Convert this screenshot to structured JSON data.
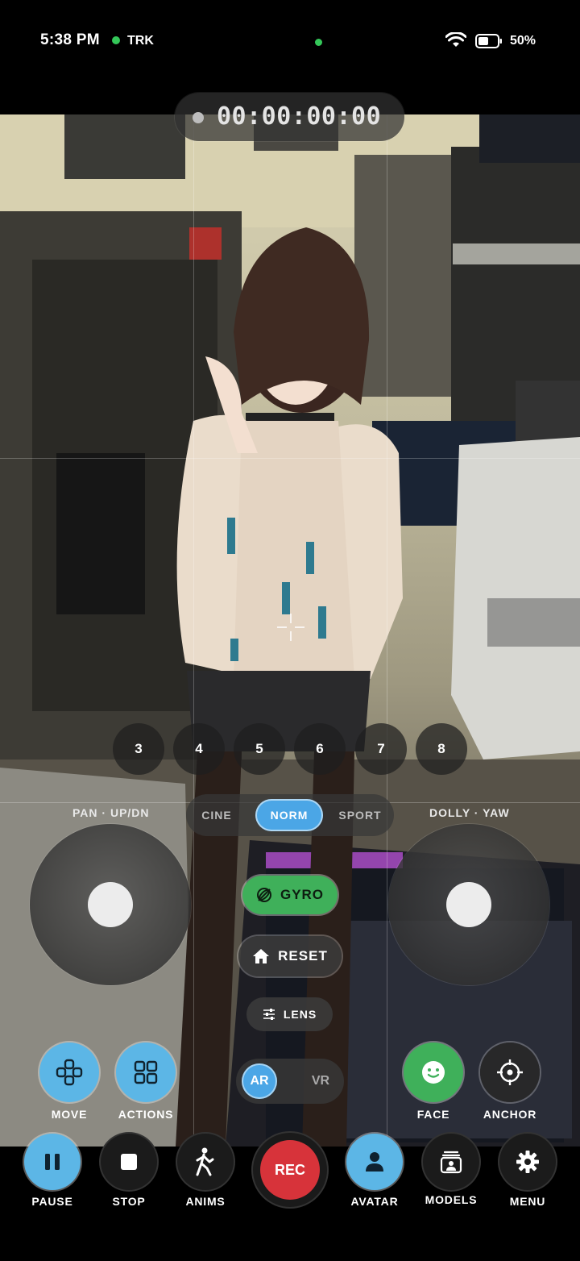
{
  "status_bar": {
    "time": "5:38 PM",
    "tracking": "TRK",
    "battery": "50%"
  },
  "timecode": "00:00:00:00",
  "camera_numbers": [
    "3",
    "4",
    "5",
    "6",
    "7",
    "8"
  ],
  "mode": {
    "options": [
      "CINE",
      "NORM",
      "SPORT"
    ],
    "selected": "NORM"
  },
  "joysticks": {
    "left_label": "PAN · UP/DN",
    "right_label": "DOLLY · YAW"
  },
  "controls": {
    "gyro": "GYRO",
    "reset": "RESET",
    "lens": "LENS",
    "ar": "AR",
    "vr": "VR",
    "selected_view": "AR"
  },
  "side_buttons": {
    "move": "MOVE",
    "actions": "ACTIONS",
    "face": "FACE",
    "anchor": "ANCHOR"
  },
  "toolbar": {
    "pause": "PAUSE",
    "stop": "STOP",
    "anims": "ANIMS",
    "rec": "REC",
    "avatar": "AVATAR",
    "models": "MODELS",
    "menu": "MENU"
  },
  "colors": {
    "accent_blue": "#4ba6e6",
    "gyro_green": "#3fb05a",
    "face_green": "#3fb05a",
    "rec_red": "#d7333a"
  },
  "icons": [
    "dpad-icon",
    "grid-icon",
    "smile-icon",
    "crosshair-icon",
    "pause-icon",
    "stop-icon",
    "walking-figure-icon",
    "person-icon",
    "portrait-stack-icon",
    "gear-icon",
    "home-icon",
    "sliders-icon",
    "gyro-icon"
  ]
}
